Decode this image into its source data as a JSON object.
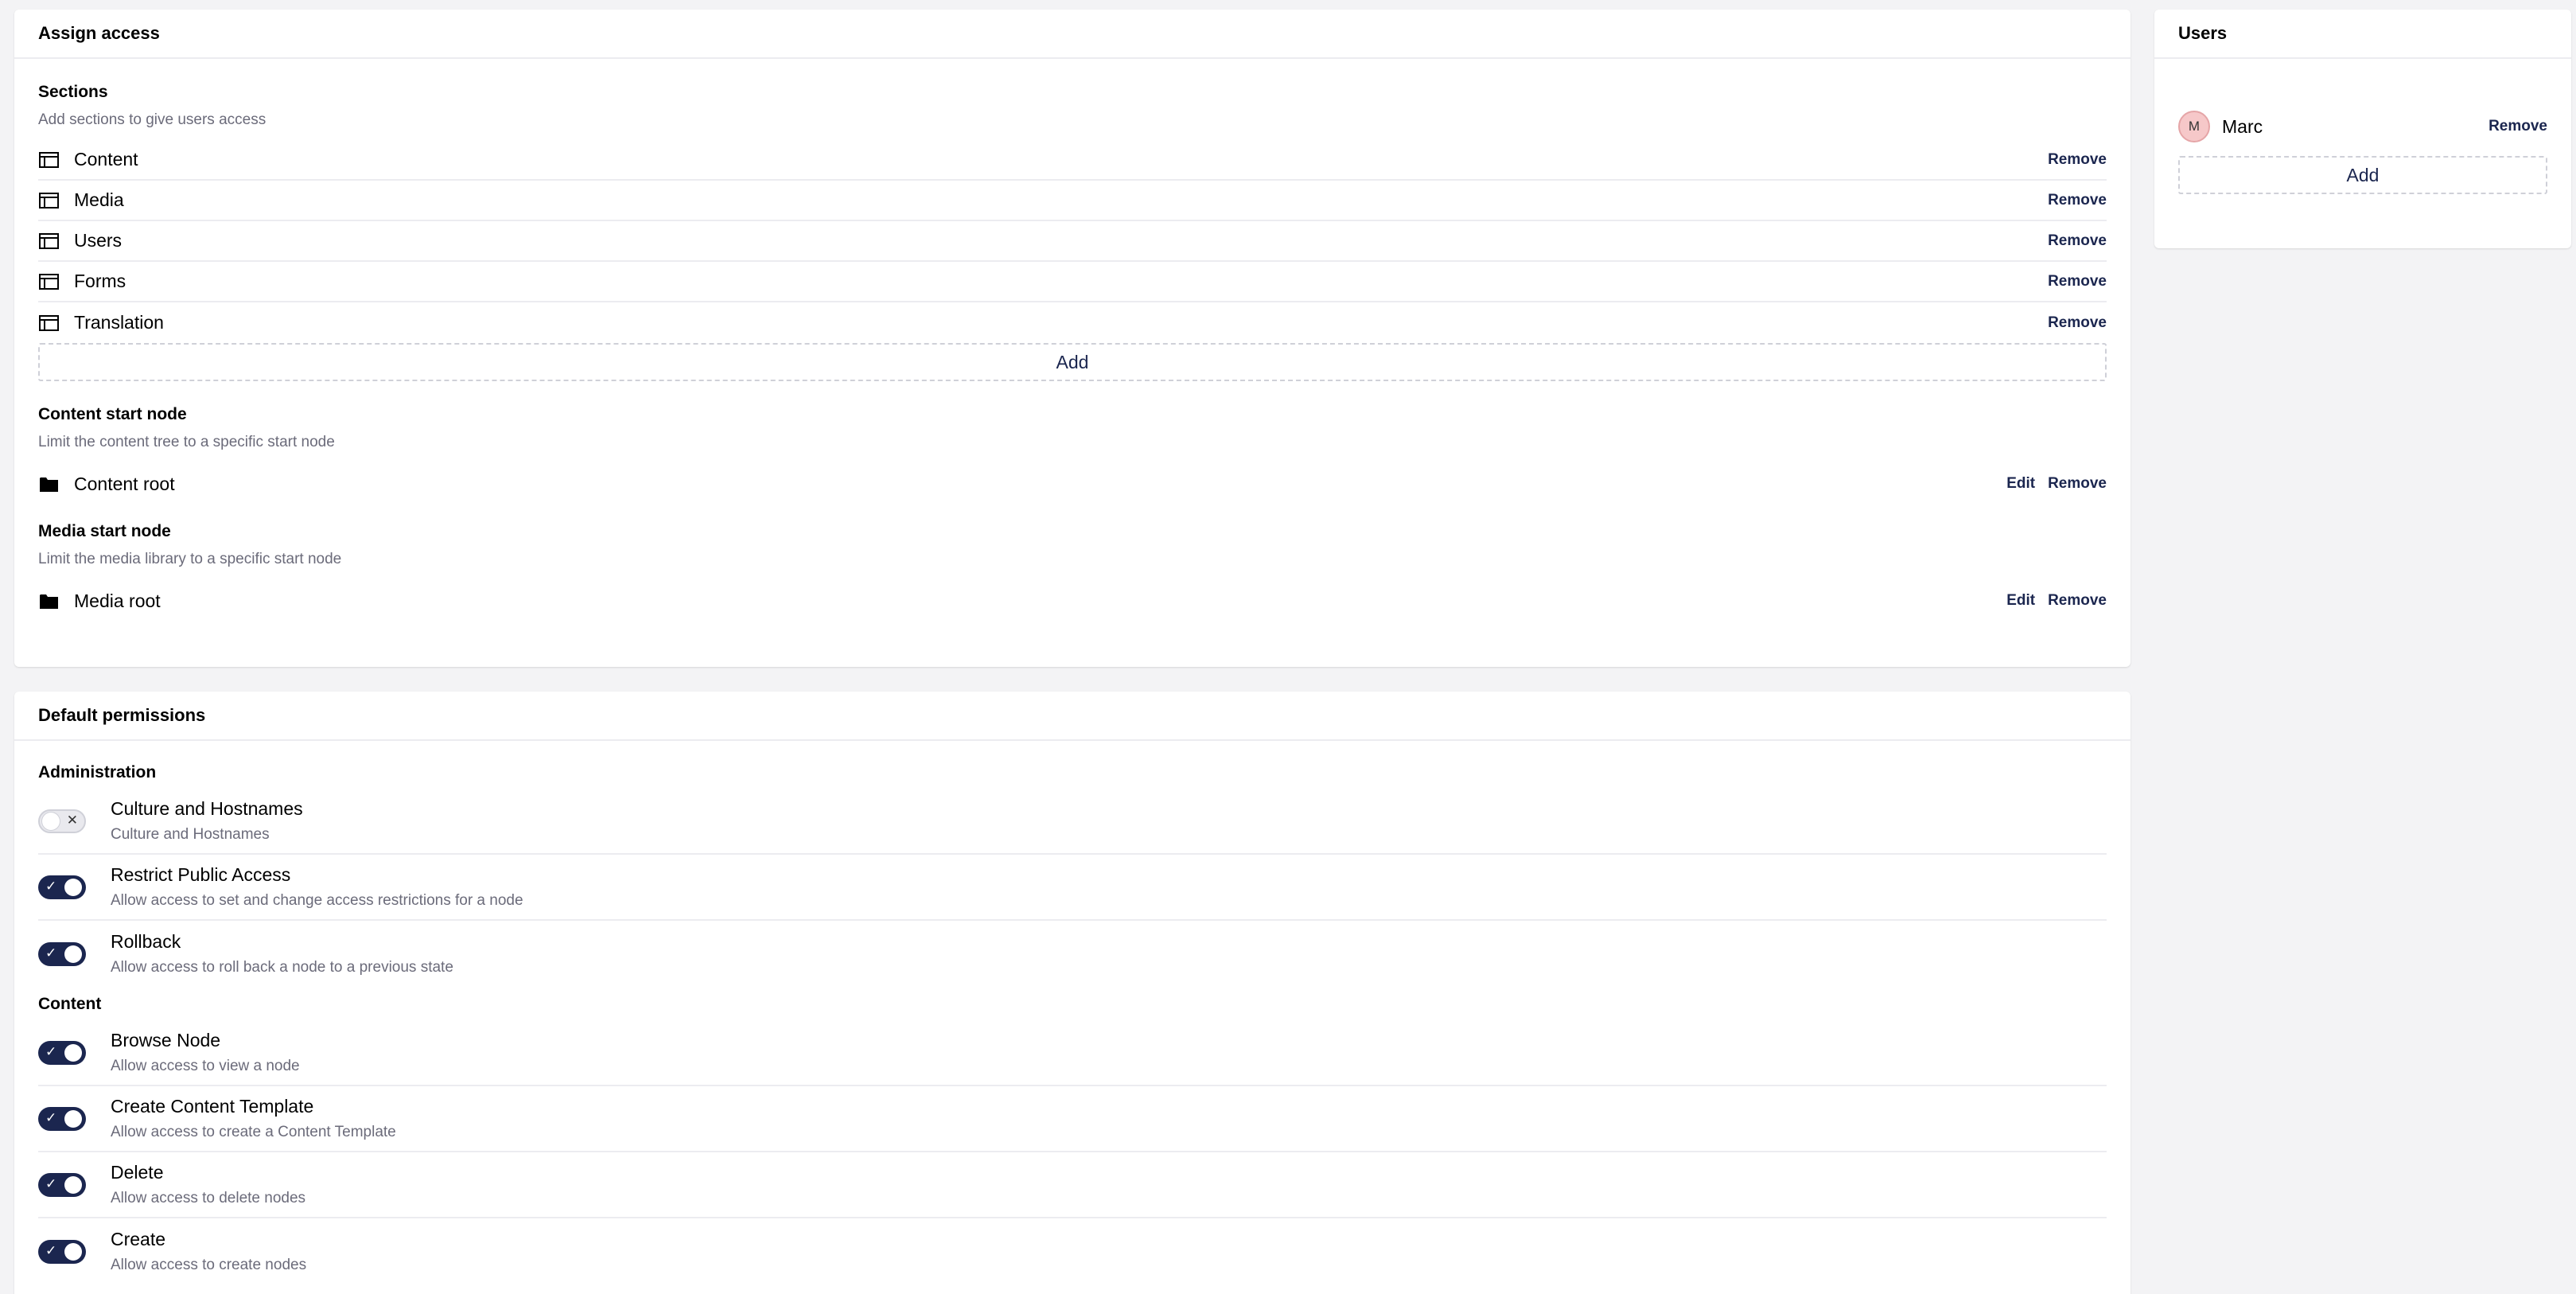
{
  "assign_access": {
    "title": "Assign access",
    "sections": {
      "title": "Sections",
      "description": "Add sections to give users access",
      "items": [
        {
          "label": "Content",
          "icon": "section-window-icon"
        },
        {
          "label": "Media",
          "icon": "section-window-icon"
        },
        {
          "label": "Users",
          "icon": "section-window-icon"
        },
        {
          "label": "Forms",
          "icon": "section-window-icon"
        },
        {
          "label": "Translation",
          "icon": "section-window-icon"
        }
      ],
      "remove_label": "Remove",
      "add_label": "Add"
    },
    "content_start_node": {
      "title": "Content start node",
      "description": "Limit the content tree to a specific start node",
      "node_label": "Content root",
      "icon": "folder-icon",
      "edit_label": "Edit",
      "remove_label": "Remove"
    },
    "media_start_node": {
      "title": "Media start node",
      "description": "Limit the media library to a specific start node",
      "node_label": "Media root",
      "icon": "folder-icon",
      "edit_label": "Edit",
      "remove_label": "Remove"
    }
  },
  "users_panel": {
    "title": "Users",
    "users": [
      {
        "initial": "M",
        "name": "Marc",
        "remove_label": "Remove"
      }
    ],
    "add_label": "Add"
  },
  "default_permissions": {
    "title": "Default permissions",
    "groups": [
      {
        "label": "Administration",
        "items": [
          {
            "title": "Culture and Hostnames",
            "description": "Culture and Hostnames",
            "enabled": false
          },
          {
            "title": "Restrict Public Access",
            "description": "Allow access to set and change access restrictions for a node",
            "enabled": true
          },
          {
            "title": "Rollback",
            "description": "Allow access to roll back a node to a previous state",
            "enabled": true
          }
        ]
      },
      {
        "label": "Content",
        "items": [
          {
            "title": "Browse Node",
            "description": "Allow access to view a node",
            "enabled": true
          },
          {
            "title": "Create Content Template",
            "description": "Allow access to create a Content Template",
            "enabled": true
          },
          {
            "title": "Delete",
            "description": "Allow access to delete nodes",
            "enabled": true
          },
          {
            "title": "Create",
            "description": "Allow access to create nodes",
            "enabled": true
          }
        ]
      }
    ],
    "toggle_on_mark": "✓",
    "toggle_off_mark": "✕"
  },
  "colors": {
    "background": "#f3f3f5",
    "card": "#ffffff",
    "accent": "#1b264f",
    "avatar": "#f6c8c9"
  }
}
